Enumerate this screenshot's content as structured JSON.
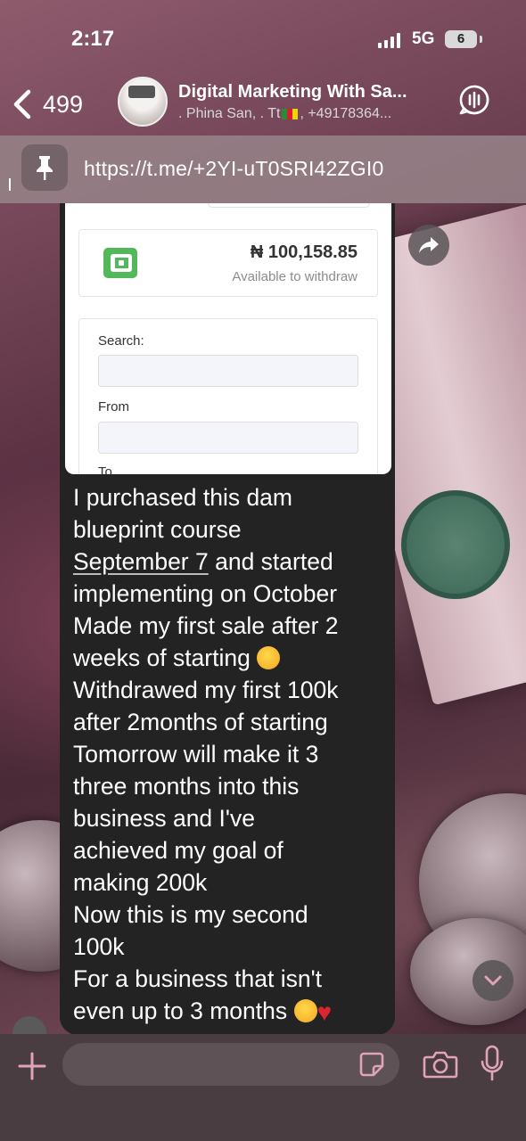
{
  "status_bar": {
    "time": "2:17",
    "network": "5G",
    "battery": "6"
  },
  "chat_header": {
    "back_count": "499",
    "title": "Digital Marketing With Sa...",
    "subtitle_left": ". Phina San, . Tt",
    "subtitle_right": ", +49178364..."
  },
  "pinned": {
    "link": "https://t.me/+2YI-uT0SRI42ZGI0"
  },
  "message": {
    "screenshot": {
      "amount": "₦ 100,158.85",
      "amount_caption": "Available to withdraw",
      "search_label": "Search:",
      "from_label": "From",
      "to_label": "To"
    },
    "lines": [
      "I purchased this dam",
      "blueprint course",
      "September 7",
      " and started",
      "implementing on October",
      "Made my first sale after 2",
      "weeks of starting",
      "Withdrawed my first 100k",
      "after 2months of starting",
      "Tomorrow will make it 3",
      "three months into this",
      "business and I've",
      "achieved my goal of",
      "making 200k",
      "Now this is my second",
      "100k",
      "For a business that isn't",
      "even up to 3 months"
    ]
  },
  "icons": {
    "back": "chevron-left-icon",
    "call": "voice-chat-icon",
    "pin": "pin-icon",
    "forward": "forward-icon",
    "scroll": "chevron-down-icon",
    "attach": "plus-icon",
    "sticker": "sticker-icon",
    "camera": "camera-icon",
    "mic": "microphone-icon"
  },
  "colors": {
    "bubble": "#232323",
    "wallet_green": "#53b85c",
    "accent_pink": "#e0a4b8"
  }
}
